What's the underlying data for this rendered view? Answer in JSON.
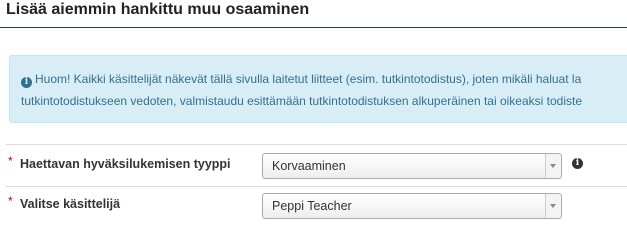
{
  "page": {
    "title": "Lisää aiemmin hankittu muu osaaminen"
  },
  "notice": {
    "icon": "info-circle-icon",
    "line1": "Huom! Kaikki käsittelijät näkevät tällä sivulla laitetut liitteet (esim. tutkintotodistus), joten mikäli haluat la",
    "line2": "tutkintotodistukseen vedoten, valmistaudu esittämään tutkintotodistuksen alkuperäinen tai oikeaksi todiste"
  },
  "form": {
    "required_marker": "*",
    "recognition_type": {
      "label": "Haettavan hyväksilukemisen tyyppi",
      "selected": "Korvaaminen",
      "help_icon": "info-circle-icon"
    },
    "handler": {
      "label": "Valitse käsittelijä",
      "selected": "Peppi Teacher"
    }
  },
  "colors": {
    "notice_bg": "#d9edf7",
    "notice_text": "#31708f",
    "required": "#cc0000"
  }
}
